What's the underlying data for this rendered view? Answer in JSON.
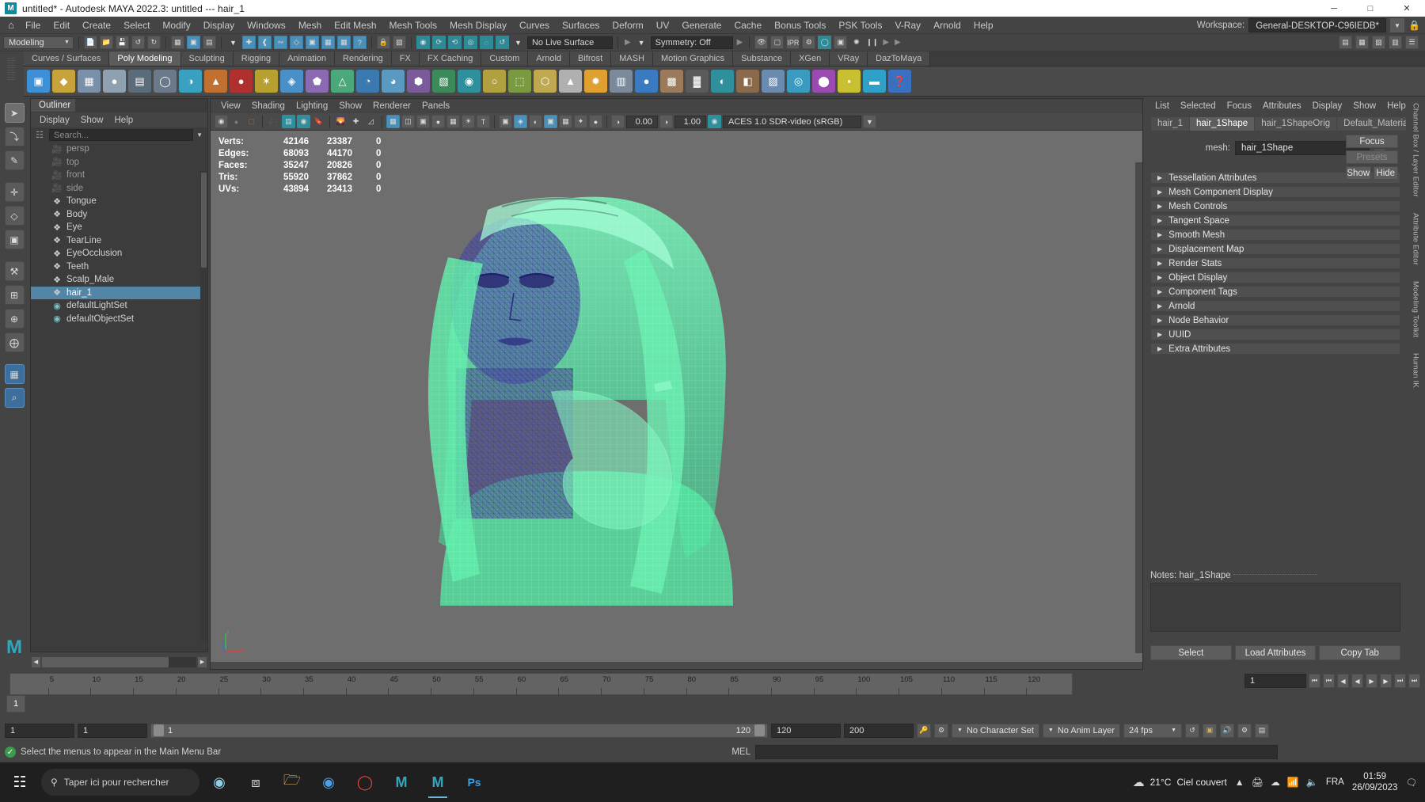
{
  "window": {
    "title": "untitled* - Autodesk MAYA 2022.3: untitled   ---   hair_1",
    "app_icon": "M",
    "minimize": "─",
    "maximize": "□",
    "close": "✕"
  },
  "menubar": {
    "home_icon": "home-icon",
    "items": [
      "File",
      "Edit",
      "Create",
      "Select",
      "Modify",
      "Display",
      "Windows",
      "Mesh",
      "Edit Mesh",
      "Mesh Tools",
      "Mesh Display",
      "Curves",
      "Surfaces",
      "Deform",
      "UV",
      "Generate",
      "Cache",
      "Bonus Tools",
      "PSK Tools",
      "V-Ray",
      "Arnold",
      "Help"
    ],
    "workspace_label": "Workspace:",
    "workspace_value": "General-DESKTOP-C96IEDB*",
    "lock_icon": "lock-icon"
  },
  "statusbar": {
    "mode": "Modeling",
    "live_surface": "No Live Surface",
    "symmetry": "Symmetry: Off"
  },
  "shelf": {
    "tabs": [
      "Curves / Surfaces",
      "Poly Modeling",
      "Sculpting",
      "Rigging",
      "Animation",
      "Rendering",
      "FX",
      "FX Caching",
      "Custom",
      "Arnold",
      "Bifrost",
      "MASH",
      "Motion Graphics",
      "Substance",
      "XGen",
      "VRay",
      "DazToMaya"
    ],
    "active_tab": "Poly Modeling"
  },
  "toolbox": {
    "items": [
      {
        "name": "select-tool",
        "glyph": "➤"
      },
      {
        "name": "lasso-select-tool",
        "glyph": "⤵"
      },
      {
        "name": "paint-select-tool",
        "glyph": "✎"
      },
      {
        "name": "move-tool",
        "glyph": "✛"
      },
      {
        "name": "rotate-tool",
        "glyph": "◇"
      },
      {
        "name": "scale-tool",
        "glyph": "▣"
      },
      {
        "name": "last-tool",
        "glyph": "⚒"
      },
      {
        "name": "snap-grid-tool",
        "glyph": "⊞"
      },
      {
        "name": "snap-curve-tool",
        "glyph": "⊕"
      },
      {
        "name": "snap-point-tool",
        "glyph": "⨁"
      },
      {
        "name": "four-view-layout",
        "glyph": "▦"
      },
      {
        "name": "magnify-tool",
        "glyph": "⌕"
      }
    ]
  },
  "outliner": {
    "tab_label": "Outliner",
    "menu": [
      "Display",
      "Show",
      "Help"
    ],
    "search_placeholder": "Search...",
    "search_icon": "search-icon",
    "items": [
      {
        "label": "persp",
        "icon": "camera-icon",
        "type": "camera",
        "dim": true,
        "selected": false
      },
      {
        "label": "top",
        "icon": "camera-icon",
        "type": "camera",
        "dim": true,
        "selected": false
      },
      {
        "label": "front",
        "icon": "camera-icon",
        "type": "camera",
        "dim": true,
        "selected": false
      },
      {
        "label": "side",
        "icon": "camera-icon",
        "type": "camera",
        "dim": true,
        "selected": false
      },
      {
        "label": "Tongue",
        "icon": "mesh-icon",
        "type": "mesh",
        "dim": false,
        "selected": false
      },
      {
        "label": "Body",
        "icon": "mesh-icon",
        "type": "mesh",
        "dim": false,
        "selected": false
      },
      {
        "label": "Eye",
        "icon": "mesh-icon",
        "type": "mesh",
        "dim": false,
        "selected": false
      },
      {
        "label": "TearLine",
        "icon": "mesh-icon",
        "type": "mesh",
        "dim": false,
        "selected": false
      },
      {
        "label": "EyeOcclusion",
        "icon": "mesh-icon",
        "type": "mesh",
        "dim": false,
        "selected": false
      },
      {
        "label": "Teeth",
        "icon": "mesh-icon",
        "type": "mesh",
        "dim": false,
        "selected": false
      },
      {
        "label": "Scalp_Male",
        "icon": "mesh-icon",
        "type": "mesh",
        "dim": false,
        "selected": false
      },
      {
        "label": "hair_1",
        "icon": "mesh-icon",
        "type": "mesh",
        "dim": false,
        "selected": true
      },
      {
        "label": "defaultLightSet",
        "icon": "set-icon",
        "type": "set",
        "dim": false,
        "selected": false
      },
      {
        "label": "defaultObjectSet",
        "icon": "set-icon",
        "type": "set",
        "dim": false,
        "selected": false
      }
    ]
  },
  "viewport": {
    "menu": [
      "View",
      "Shading",
      "Lighting",
      "Show",
      "Renderer",
      "Panels"
    ],
    "exposure": "0.00",
    "gamma": "1.00",
    "color_space": "ACES 1.0 SDR-video (sRGB)",
    "hud": {
      "rows": [
        {
          "label": "Verts:",
          "total": "42146",
          "selected": "23387",
          "third": "0"
        },
        {
          "label": "Edges:",
          "total": "68093",
          "selected": "44170",
          "third": "0"
        },
        {
          "label": "Faces:",
          "total": "35247",
          "selected": "20826",
          "third": "0"
        },
        {
          "label": "Tris:",
          "total": "55920",
          "selected": "37862",
          "third": "0"
        },
        {
          "label": "UVs:",
          "total": "43894",
          "selected": "23413",
          "third": "0"
        }
      ]
    },
    "axis": {
      "x": "x",
      "y": "y",
      "z": "z"
    }
  },
  "attribute_editor": {
    "menu": [
      "List",
      "Selected",
      "Focus",
      "Attributes",
      "Display",
      "Show",
      "Help"
    ],
    "tabs": [
      "hair_1",
      "hair_1Shape",
      "hair_1ShapeOrig",
      "Default_Material"
    ],
    "active_tab": "hair_1Shape",
    "mesh_label": "mesh:",
    "mesh_value": "hair_1Shape",
    "focus_button": "Focus",
    "presets_button": "Presets",
    "show_button": "Show",
    "hide_button": "Hide",
    "sections": [
      "Tessellation Attributes",
      "Mesh Component Display",
      "Mesh Controls",
      "Tangent Space",
      "Smooth Mesh",
      "Displacement Map",
      "Render Stats",
      "Object Display",
      "Component Tags",
      "Arnold",
      "Node Behavior",
      "UUID",
      "Extra Attributes"
    ],
    "notes_label": "Notes:",
    "notes_value": "hair_1Shape",
    "bottom_buttons": [
      "Select",
      "Load Attributes",
      "Copy Tab"
    ]
  },
  "right_rail": {
    "tabs": [
      "Channel Box / Layer Editor",
      "Attribute Editor",
      "Modeling Toolkit",
      "Human IK"
    ]
  },
  "timeline": {
    "current_frame": "1",
    "ticks": [
      "5",
      "10",
      "15",
      "20",
      "25",
      "30",
      "35",
      "40",
      "45",
      "50",
      "55",
      "60",
      "65",
      "70",
      "75",
      "80",
      "85",
      "90",
      "95",
      "100",
      "105",
      "110",
      "115",
      "120"
    ],
    "frame_field": "1",
    "playback_buttons": [
      "⏮",
      "⏪",
      "◀",
      "▶",
      "▶",
      "⏩",
      "⏭"
    ]
  },
  "range": {
    "start": "1",
    "start2": "1",
    "slider_start": "1",
    "slider_end": "120",
    "end": "120",
    "end2": "200",
    "character_set": "No Character Set",
    "anim_layer": "No Anim Layer",
    "fps": "24 fps"
  },
  "command": {
    "help_text": "Select the menus to appear in the Main Menu Bar",
    "mel_label": "MEL",
    "mel_value": ""
  },
  "taskbar": {
    "start_icon": "windows-start-icon",
    "search_placeholder": "Taper ici pour rechercher",
    "search_icon": "search-icon",
    "apps": [
      {
        "name": "task-view-icon",
        "glyph": "⧉"
      },
      {
        "name": "file-explorer-icon",
        "glyph": "Ὄ1"
      },
      {
        "name": "chrome-icon",
        "glyph": "●"
      },
      {
        "name": "opera-icon",
        "glyph": "O"
      },
      {
        "name": "maya-icon-1",
        "glyph": "M"
      },
      {
        "name": "maya-icon-2",
        "glyph": "M"
      },
      {
        "name": "photoshop-icon",
        "glyph": "Ps"
      }
    ],
    "weather_temp": "21°C",
    "weather_desc": "Ciel couvert",
    "weather_icon": "cloud-icon",
    "language": "FRA",
    "time": "01:59",
    "date": "26/09/2023",
    "notification_icon": "notification-icon"
  },
  "colors": {
    "accent_blue": "#5285a6",
    "teal": "#2f8f9c",
    "panel_bg": "#444444",
    "viewport_bg": "#6e6e6e",
    "wire_green": "#5dffb0",
    "wire_blue": "#3a3a8c"
  }
}
